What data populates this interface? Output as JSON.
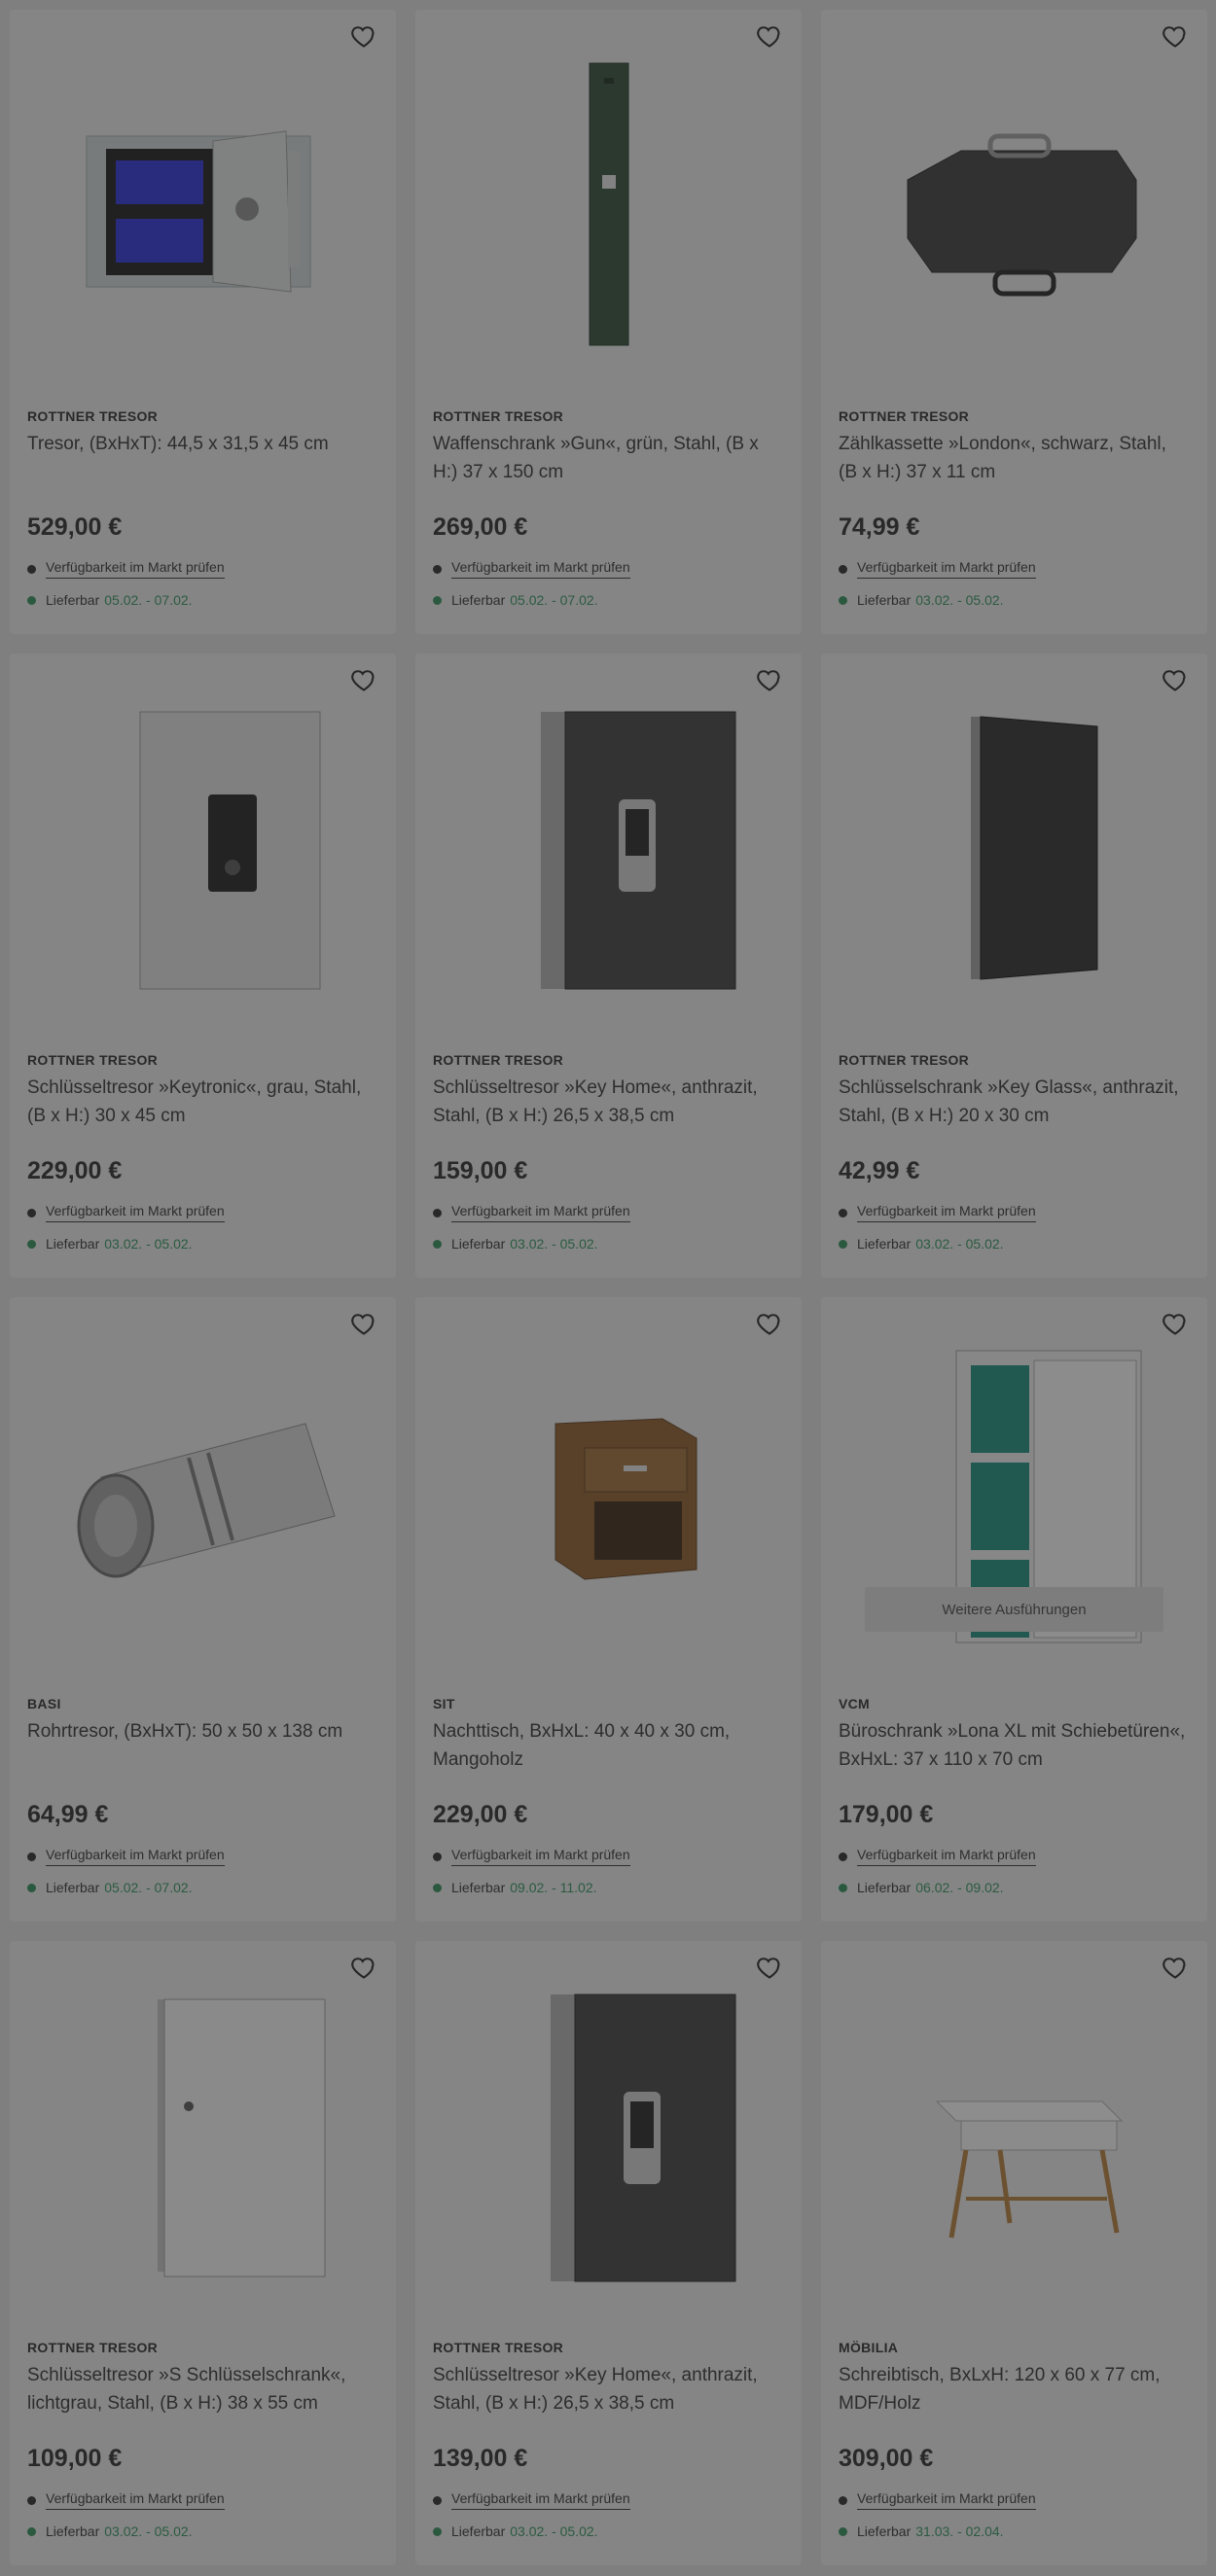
{
  "products": [
    {
      "brand": "ROTTNER TRESOR",
      "title": "Tresor, (BxHxT): 44,5 x 31,5 x 45 cm",
      "price": "529,00 €",
      "availability_link": "Verfügbarkeit im Markt prüfen",
      "delivery_label": "Lieferbar",
      "delivery_dates": "05.02. - 07.02.",
      "image": "safe-icon"
    },
    {
      "brand": "ROTTNER TRESOR",
      "title": "Waffenschrank »Gun«, grün, Stahl, (B x H:) 37 x 150 cm",
      "price": "269,00 €",
      "availability_link": "Verfügbarkeit im Markt prüfen",
      "delivery_label": "Lieferbar",
      "delivery_dates": "05.02. - 07.02.",
      "image": "gun-cabinet-icon"
    },
    {
      "brand": "ROTTNER TRESOR",
      "title": "Zählkassette »London«, schwarz, Stahl, (B x H:) 37 x 11 cm",
      "price": "74,99 €",
      "availability_link": "Verfügbarkeit im Markt prüfen",
      "delivery_label": "Lieferbar",
      "delivery_dates": "03.02. - 05.02.",
      "image": "cash-box-icon"
    },
    {
      "brand": "ROTTNER TRESOR",
      "title": "Schlüsseltresor »Keytronic«, grau, Stahl, (B x H:) 30 x 45 cm",
      "price": "229,00 €",
      "availability_link": "Verfügbarkeit im Markt prüfen",
      "delivery_label": "Lieferbar",
      "delivery_dates": "03.02. - 05.02.",
      "image": "key-safe-keypad-icon"
    },
    {
      "brand": "ROTTNER TRESOR",
      "title": "Schlüsseltresor »Key Home«, anthrazit, Stahl, (B x H:) 26,5 x 38,5 cm",
      "price": "159,00 €",
      "availability_link": "Verfügbarkeit im Markt prüfen",
      "delivery_label": "Lieferbar",
      "delivery_dates": "03.02. - 05.02.",
      "image": "key-home-safe-icon"
    },
    {
      "brand": "ROTTNER TRESOR",
      "title": "Schlüsselschrank »Key Glass«, anthrazit, Stahl, (B x H:) 20 x 30 cm",
      "price": "42,99 €",
      "availability_link": "Verfügbarkeit im Markt prüfen",
      "delivery_label": "Lieferbar",
      "delivery_dates": "03.02. - 05.02.",
      "image": "key-glass-cabinet-icon"
    },
    {
      "brand": "BASI",
      "title": "Rohrtresor, (BxHxT): 50 x 50 x 138 cm",
      "price": "64,99 €",
      "availability_link": "Verfügbarkeit im Markt prüfen",
      "delivery_label": "Lieferbar",
      "delivery_dates": "05.02. - 07.02.",
      "image": "tube-safe-icon"
    },
    {
      "brand": "SIT",
      "title": "Nachttisch, BxHxL: 40 x 40 x 30 cm, Mangoholz",
      "price": "229,00 €",
      "availability_link": "Verfügbarkeit im Markt prüfen",
      "delivery_label": "Lieferbar",
      "delivery_dates": "09.02. - 11.02.",
      "image": "nightstand-icon"
    },
    {
      "brand": "VCM",
      "title": "Büroschrank »Lona XL mit Schiebetüren«, BxHxL: 37 x 110 x 70 cm",
      "price": "179,00 €",
      "availability_link": "Verfügbarkeit im Markt prüfen",
      "delivery_label": "Lieferbar",
      "delivery_dates": "06.02. - 09.02.",
      "image": "office-cabinet-icon",
      "variants_button": "Weitere Ausführungen"
    },
    {
      "brand": "ROTTNER TRESOR",
      "title": "Schlüsseltresor »S Schlüsselschrank«, lichtgrau, Stahl, (B x H:) 38 x 55 cm",
      "price": "109,00 €",
      "availability_link": "Verfügbarkeit im Markt prüfen",
      "delivery_label": "Lieferbar",
      "delivery_dates": "03.02. - 05.02.",
      "image": "key-cabinet-light-icon"
    },
    {
      "brand": "ROTTNER TRESOR",
      "title": "Schlüsseltresor »Key Home«, anthrazit, Stahl, (B x H:) 26,5 x 38,5 cm",
      "price": "139,00 €",
      "availability_link": "Verfügbarkeit im Markt prüfen",
      "delivery_label": "Lieferbar",
      "delivery_dates": "03.02. - 05.02.",
      "image": "key-home-safe-icon"
    },
    {
      "brand": "MÖBILIA",
      "title": "Schreibtisch, BxLxH: 120 x 60 x 77 cm, MDF/Holz",
      "price": "309,00 €",
      "availability_link": "Verfügbarkeit im Markt prüfen",
      "delivery_label": "Lieferbar",
      "delivery_dates": "31.03. - 02.04.",
      "image": "desk-icon"
    }
  ],
  "colors": {
    "delivery_green": "#2f8f5a",
    "overlay": "rgba(40,40,40,0.5)"
  }
}
